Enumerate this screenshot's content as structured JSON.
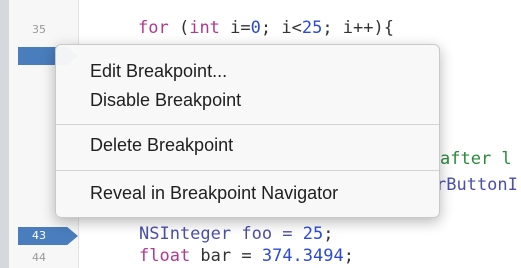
{
  "editor": {
    "line_numbers": {
      "l35": "35",
      "l43": "43",
      "l44": "44"
    },
    "code": {
      "line35": {
        "kw_for": "for",
        "p1": " (",
        "kw_int": "int",
        "p2": " i=",
        "n0": "0",
        "p3": "; i<",
        "n25": "25",
        "p4": "; i++){"
      },
      "line43": {
        "ident": "NSInteger foo = ",
        "n": "25",
        "end": ";"
      },
      "line44": {
        "kw": "float",
        "rest": " bar = ",
        "n": "374.3494",
        "end": ";"
      }
    },
    "partial_text": {
      "comment": "after l",
      "identifier": "rButtonI"
    },
    "colors": {
      "breakpoint": "#4a7dbd",
      "keyword": "#b03a8f",
      "number": "#2b4bd6"
    }
  },
  "context_menu": {
    "items": [
      {
        "label": "Edit Breakpoint..."
      },
      {
        "label": "Disable Breakpoint"
      },
      {
        "label": "Delete Breakpoint"
      },
      {
        "label": "Reveal in Breakpoint Navigator"
      }
    ]
  }
}
